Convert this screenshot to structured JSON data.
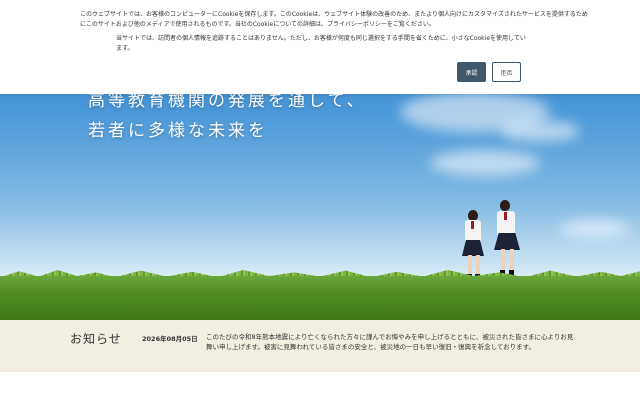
{
  "cookie_banner": {
    "text_main": "このウェブサイトでは、お客様のコンピューターにCookieを保存します。このCookieは、ウェブサイト体験の改善のため、またより個人向けにカスタマイズされたサービスを提供するためにこのサイトおよび他のメディアで使用されるものです。当社のCookieについての詳細は、プライバシーポリシーをご覧ください。",
    "text_secondary": "当サイトでは、訪問者の個人情報を追跡することはありません。ただし、お客様が何度も同じ選択をする手間を省くために、小さなCookieを使用しています。",
    "accept_label": "承認",
    "reject_label": "拒否",
    "accent_color": "#3f5769"
  },
  "hero": {
    "headline_line1": "高等教育機関の発展を通して、",
    "headline_line2": "若者に多様な未来を"
  },
  "news": {
    "heading": "お知らせ",
    "date": "2026年08月05日",
    "body": "このたびの令和8年熊本地震により亡くなられた方々に謹んでお悔やみを申し上げるとともに、被災された皆さまに心よりお見舞い申し上げます。被害に見舞われている皆さまの安全と、被災地の一日も早い復旧・復興を祈念しております。",
    "background_color": "#f2efe2"
  }
}
